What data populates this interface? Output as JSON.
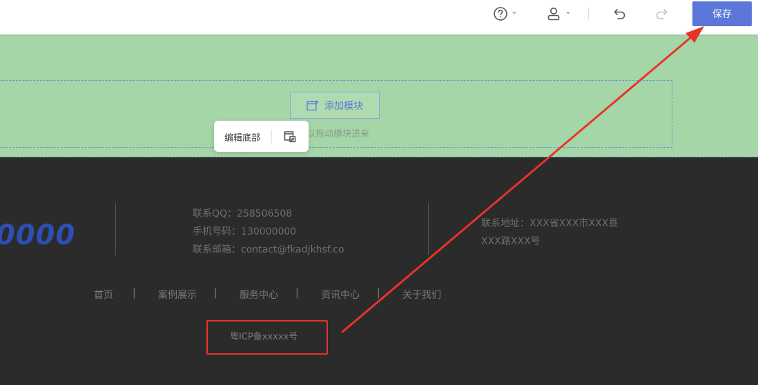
{
  "toolbar": {
    "help_icon": "help-circle-icon",
    "user_icon": "user-icon",
    "undo_icon": "undo-icon",
    "redo_icon": "redo-icon",
    "save_label": "保存"
  },
  "canvas": {
    "add_module_label": "添加模块",
    "drag_hint": "以拖动模块进来",
    "popup_label": "编辑底部",
    "popup_icon": "swap-layout-icon"
  },
  "footer": {
    "logo_text": "0000",
    "contact_lines": [
      "联系QQ：258506508",
      "手机号码：130000000",
      "联系邮箱：contact@fkadjkhsf.co"
    ],
    "address_line1": "联系地址：XXX省XXX市XXX县",
    "address_line2": "XXX路XXX号",
    "nav": [
      "首页",
      "案例展示",
      "服务中心",
      "资讯中心",
      "关于我们"
    ],
    "nav_separator": "|",
    "icp": "粤ICP备xxxxx号"
  },
  "colors": {
    "accent": "#5b77d9",
    "canvas_green": "#a5d6a7",
    "footer_bg": "#2b2b2b",
    "annotation_red": "#e8332a"
  }
}
